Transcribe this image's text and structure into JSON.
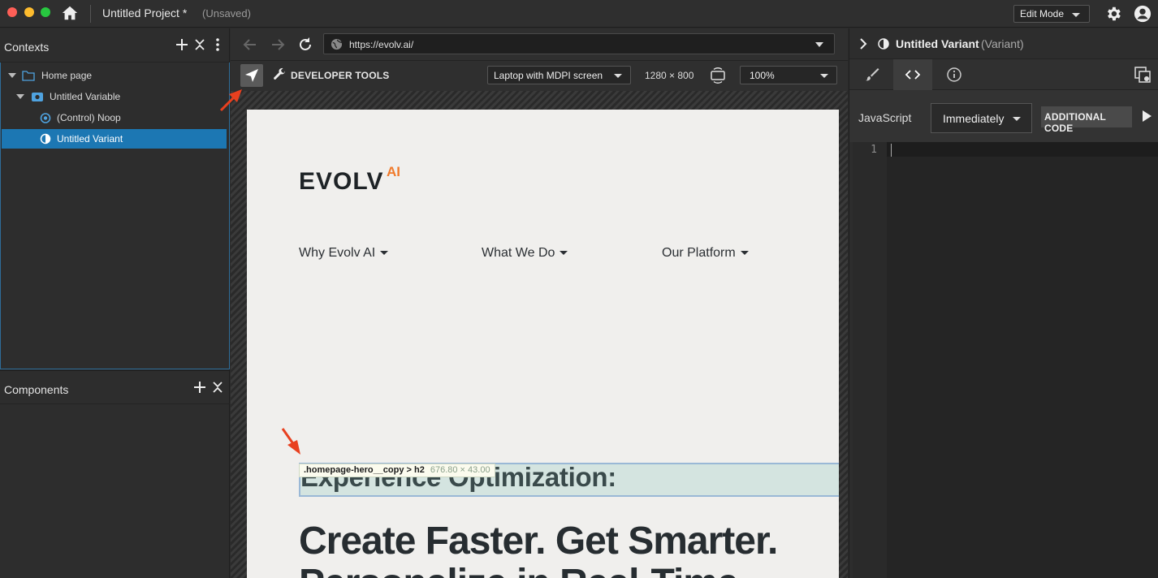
{
  "titlebar": {
    "project_title": "Untitled Project *",
    "project_status": "(Unsaved)",
    "mode": "Edit Mode"
  },
  "contexts": {
    "title": "Contexts",
    "tree": [
      {
        "label": "Home page",
        "icon": "folder-icon"
      },
      {
        "label": "Untitled Variable",
        "icon": "variable-icon"
      },
      {
        "label": "(Control) Noop",
        "icon": "control-icon"
      },
      {
        "label": "Untitled Variant",
        "icon": "variant-icon",
        "selected": true
      }
    ]
  },
  "components": {
    "title": "Components"
  },
  "browser": {
    "url": "https://evolv.ai/",
    "devtools_label": "DEVELOPER TOOLS",
    "device": "Laptop with MDPI screen",
    "dimensions": "1280 × 800",
    "zoom": "100%"
  },
  "site": {
    "logo": "EVOLV",
    "logo_suffix": "AI",
    "nav": [
      "Why Evolv AI",
      "What We Do",
      "Our Platform"
    ],
    "selector": ".homepage-hero__copy > h2",
    "selector_dims": "676.80 × 43.00",
    "hero_sub": "Experience Optimization:",
    "hero_h1_line1": "Create Faster. Get Smarter.",
    "hero_h1_line2": "Personalize in Real-Time."
  },
  "inspector": {
    "variant_name": "Untitled Variant",
    "variant_type": "(Variant)",
    "language": "JavaScript",
    "timing": "Immediately",
    "additional_code": "ADDITIONAL CODE",
    "line_number": "1"
  },
  "colors": {
    "selection_blue": "#1c77b3",
    "accent_orange": "#f07a2b",
    "annotation_arrow": "#e8401f"
  }
}
